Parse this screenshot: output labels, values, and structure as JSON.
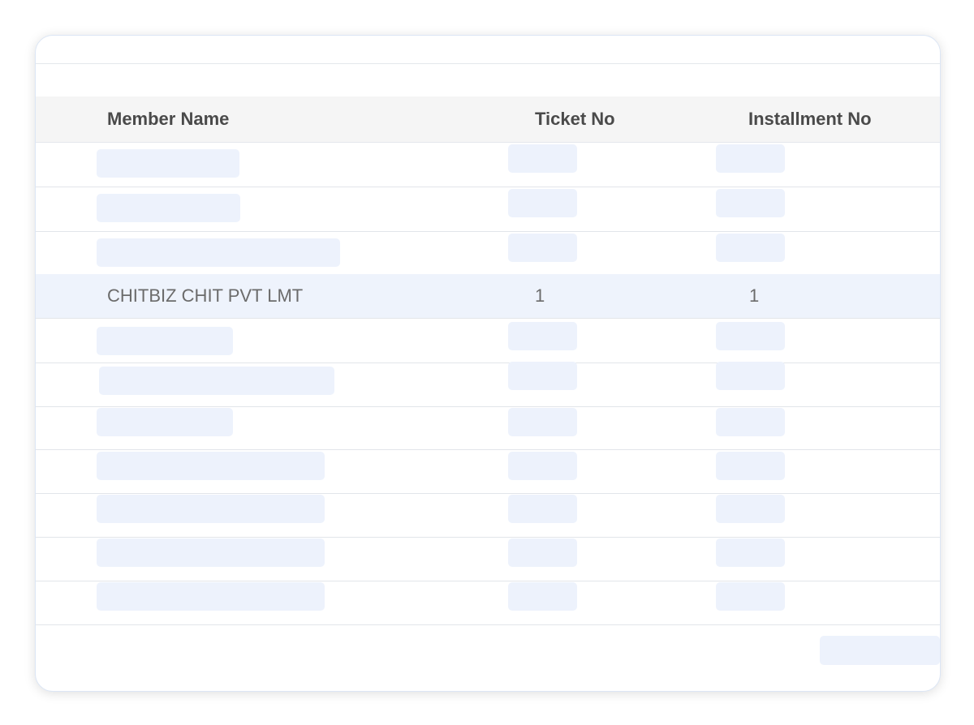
{
  "table": {
    "columns": [
      "Member Name",
      "Ticket No",
      "Installment No"
    ],
    "visible_row": {
      "member_name": "CHITBIZ CHIT PVT LMT",
      "ticket_no": "1",
      "installment_no": "1"
    }
  },
  "colors": {
    "header_bg": "#f5f5f5",
    "highlight_row_bg": "#eef3fc",
    "skeleton_bg": "#edf2fc",
    "border": "#e4e7ec"
  }
}
